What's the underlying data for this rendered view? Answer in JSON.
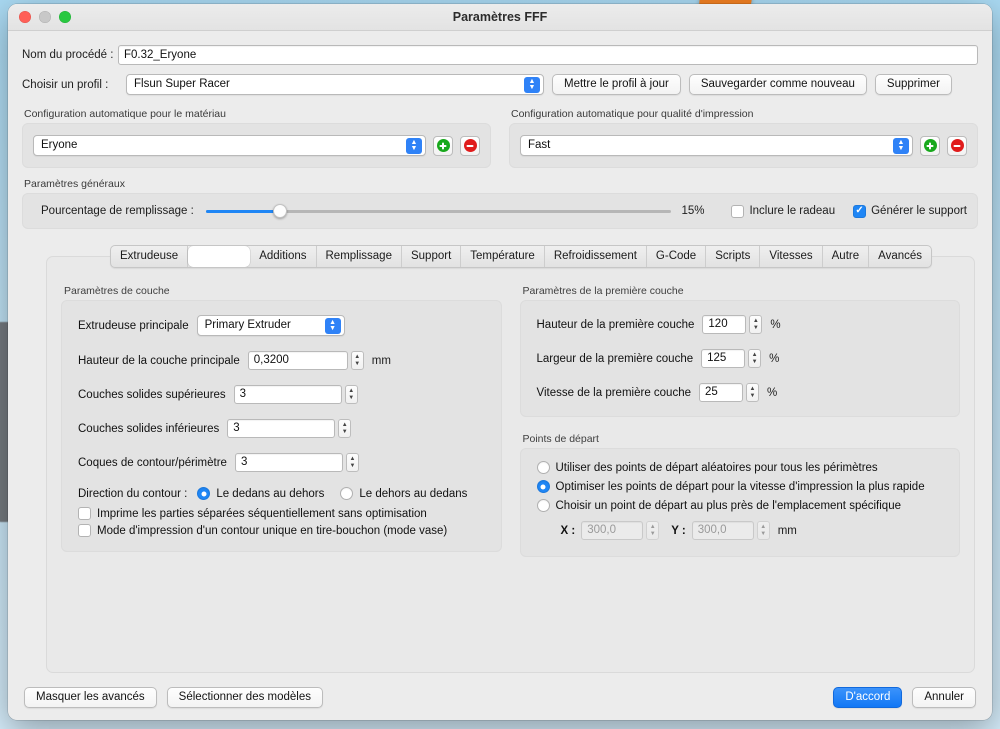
{
  "window": {
    "title": "Paramètres FFF",
    "traffic_lights": [
      "close-light",
      "minimize-light",
      "zoom-light"
    ]
  },
  "top": {
    "name_label": "Nom du procédé :",
    "name_value": "F0.32_Eryone",
    "profile_label": "Choisir un profil :",
    "profile_value": "Flsun Super Racer",
    "update_profile_button": "Mettre le profil à jour",
    "save_as_new_button": "Sauvegarder comme nouveau",
    "delete_button": "Supprimer"
  },
  "auto_config": {
    "material": {
      "title": "Configuration automatique pour le matériau",
      "value": "Eryone",
      "add_label": "+",
      "remove_label": "−"
    },
    "quality": {
      "title": "Configuration automatique pour qualité d'impression",
      "value": "Fast",
      "add_label": "+",
      "remove_label": "−"
    }
  },
  "general": {
    "title": "Paramètres généraux",
    "infill_label": "Pourcentage de remplissage :",
    "infill_value": "15%",
    "infill_percent": 15,
    "slider_position_percent": 16,
    "raft_label": "Inclure le radeau",
    "raft_checked": false,
    "support_label": "Générer le support",
    "support_checked": true
  },
  "tabs": [
    {
      "label": "Extrudeuse",
      "selected": false
    },
    {
      "label": "",
      "selected": true
    },
    {
      "label": "Additions",
      "selected": false
    },
    {
      "label": "Remplissage",
      "selected": false
    },
    {
      "label": "Support",
      "selected": false
    },
    {
      "label": "Température",
      "selected": false
    },
    {
      "label": "Refroidissement",
      "selected": false
    },
    {
      "label": "G-Code",
      "selected": false
    },
    {
      "label": "Scripts",
      "selected": false
    },
    {
      "label": "Vitesses",
      "selected": false
    },
    {
      "label": "Autre",
      "selected": false
    },
    {
      "label": "Avancés",
      "selected": false
    }
  ],
  "layer_settings": {
    "title": "Paramètres de couche",
    "extruder_label": "Extrudeuse principale",
    "extruder_value": "Primary Extruder",
    "layer_height_label": "Hauteur de la couche principale",
    "layer_height_value": "0,3200",
    "layer_height_unit": "mm",
    "top_solid_label": "Couches solides supérieures",
    "top_solid_value": "3",
    "bottom_solid_label": "Couches solides inférieures",
    "bottom_solid_value": "3",
    "perimeter_label": "Coques de contour/périmètre",
    "perimeter_value": "3",
    "direction_label": "Direction du contour :",
    "direction_inside_out": "Le dedans au dehors",
    "direction_outside_in": "Le dehors au dedans",
    "direction_selected": "inside_out",
    "sequential_label": "Imprime les parties séparées séquentiellement sans optimisation",
    "sequential_checked": false,
    "vase_label": "Mode d'impression d'un contour unique en tire-bouchon (mode vase)",
    "vase_checked": false
  },
  "first_layer": {
    "title": "Paramètres de la première couche",
    "height_label": "Hauteur de la première couche",
    "height_value": "120",
    "width_label": "Largeur de la première couche",
    "width_value": "125",
    "speed_label": "Vitesse de la première couche",
    "speed_value": "25",
    "unit": "%"
  },
  "start_points": {
    "title": "Points de départ",
    "option_random": "Utiliser des points de départ aléatoires pour tous les périmètres",
    "option_optimize": "Optimiser les points de départ pour la vitesse d'impression la plus rapide",
    "option_specific": "Choisir un point de départ au plus près de l'emplacement spécifique",
    "selected": "optimize",
    "x_label": "X :",
    "x_value": "300,0",
    "y_label": "Y :",
    "y_value": "300,0",
    "unit": "mm",
    "coords_disabled": true
  },
  "footer": {
    "hide_advanced_button": "Masquer les avancés",
    "select_models_button": "Sélectionner des modèles",
    "ok_button": "D'accord",
    "cancel_button": "Annuler"
  },
  "colors": {
    "accent": "#1f86f5",
    "window_bg": "#ececec",
    "group_bg": "#e3e3e3",
    "panel_bg": "#e9e9e9",
    "add_green": "#18a81c",
    "remove_red": "#e01b1b",
    "desktop_bg": "#bfe3f6"
  }
}
